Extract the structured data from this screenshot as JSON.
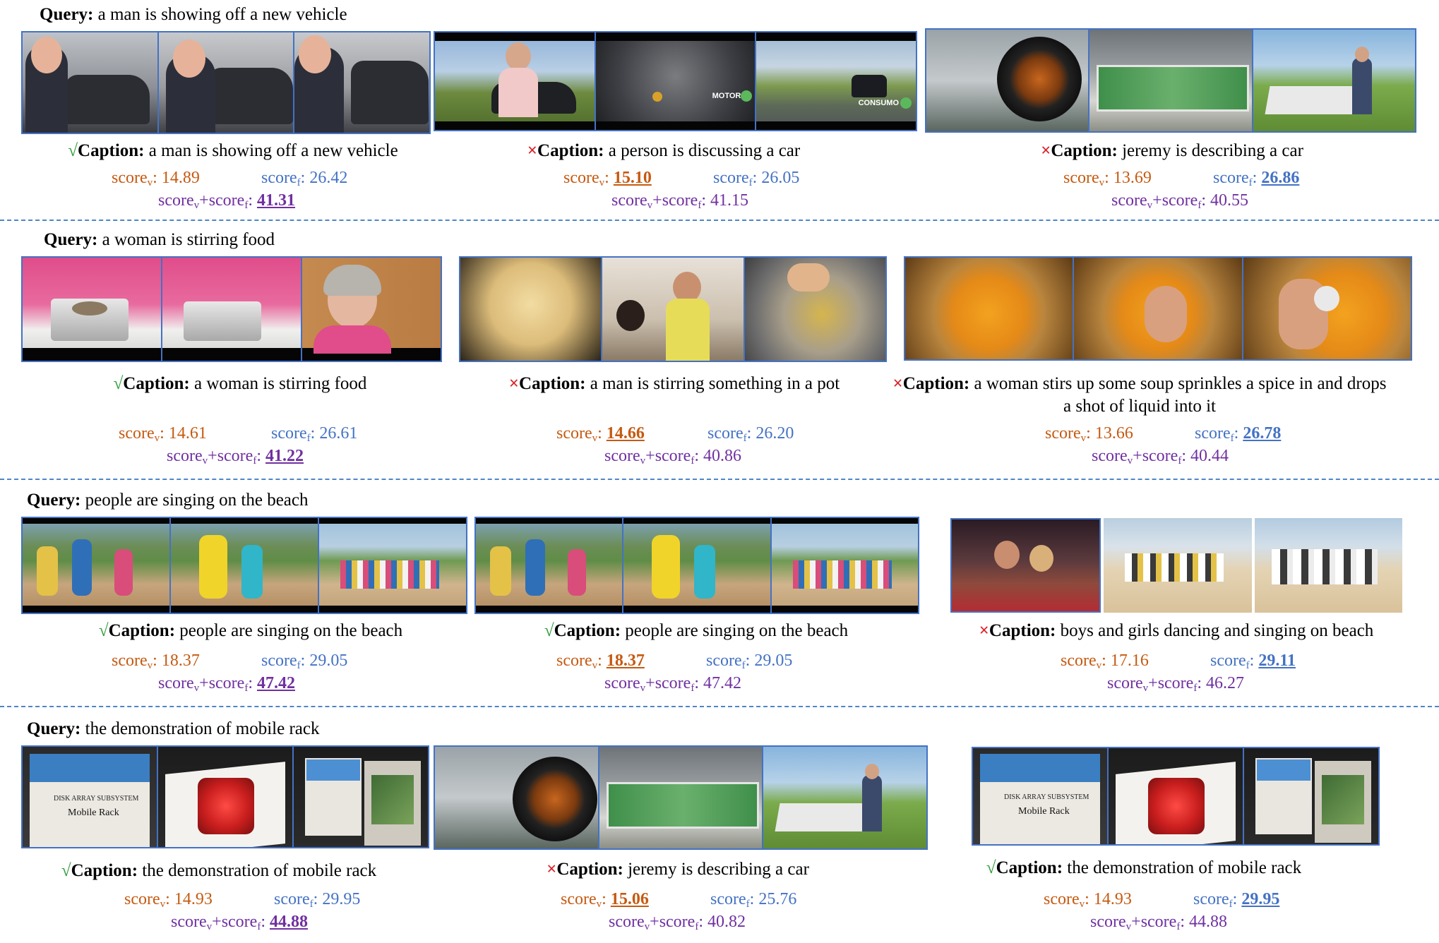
{
  "rows": [
    {
      "query_label": "Query:",
      "query_text": "a man is showing off a new vehicle",
      "results": [
        {
          "mark": "√",
          "correct": true,
          "caption_label": "Caption:",
          "caption_text": "a man is showing off a new vehicle",
          "score_v": "14.89",
          "score_f": "26.42",
          "score_sum": "41.31",
          "best": "sum",
          "frame_text": []
        },
        {
          "mark": "×",
          "correct": false,
          "caption_label": "Caption:",
          "caption_text": "a person is discussing a car",
          "score_v": "15.10",
          "score_f": "26.05",
          "score_sum": "41.15",
          "best": "v",
          "frame_text": [
            "MOTOR",
            "CONSUMO"
          ]
        },
        {
          "mark": "×",
          "correct": false,
          "caption_label": "Caption:",
          "caption_text": "jeremy is describing a car",
          "score_v": "13.69",
          "score_f": "26.86",
          "score_sum": "40.55",
          "best": "f",
          "frame_text": []
        }
      ]
    },
    {
      "query_label": "Query:",
      "query_text": "a woman is stirring food",
      "results": [
        {
          "mark": "√",
          "correct": true,
          "caption_label": "Caption:",
          "caption_text": "a woman is stirring food",
          "score_v": "14.61",
          "score_f": "26.61",
          "score_sum": "41.22",
          "best": "sum",
          "frame_text": []
        },
        {
          "mark": "×",
          "correct": false,
          "caption_label": "Caption:",
          "caption_text": "a man is stirring something in a pot",
          "score_v": "14.66",
          "score_f": "26.20",
          "score_sum": "40.86",
          "best": "v",
          "frame_text": []
        },
        {
          "mark": "×",
          "correct": false,
          "caption_label": "Caption:",
          "caption_text": "a woman stirs up some soup sprinkles a spice in and drops a shot of liquid into it",
          "score_v": "13.66",
          "score_f": "26.78",
          "score_sum": "40.44",
          "best": "f",
          "frame_text": []
        }
      ]
    },
    {
      "query_label": "Query:",
      "query_text": "people are singing on the beach",
      "results": [
        {
          "mark": "√",
          "correct": true,
          "caption_label": "Caption:",
          "caption_text": "people are singing on the beach",
          "score_v": "18.37",
          "score_f": "29.05",
          "score_sum": "47.42",
          "best": "sum",
          "frame_text": []
        },
        {
          "mark": "√",
          "correct": true,
          "caption_label": "Caption:",
          "caption_text": "people are singing on the beach",
          "score_v": "18.37",
          "score_f": "29.05",
          "score_sum": "47.42",
          "best": "v",
          "frame_text": []
        },
        {
          "mark": "×",
          "correct": false,
          "caption_label": "Caption:",
          "caption_text": "boys and girls dancing and singing on beach",
          "score_v": "17.16",
          "score_f": "29.11",
          "score_sum": "46.27",
          "best": "f",
          "frame_text": []
        }
      ]
    },
    {
      "query_label": "Query:",
      "query_text": "the demonstration of mobile rack",
      "results": [
        {
          "mark": "√",
          "correct": true,
          "caption_label": "Caption:",
          "caption_text": "the demonstration of mobile rack",
          "score_v": "14.93",
          "score_f": "29.95",
          "score_sum": "44.88",
          "best": "sum",
          "frame_text": [
            "DISK ARRAY SUBSYSTEM",
            "Mobile Rack"
          ]
        },
        {
          "mark": "×",
          "correct": false,
          "caption_label": "Caption:",
          "caption_text": "jeremy is describing a car",
          "score_v": "15.06",
          "score_f": "25.76",
          "score_sum": "40.82",
          "best": "v",
          "frame_text": []
        },
        {
          "mark": "√",
          "correct": true,
          "caption_label": "Caption:",
          "caption_text": "the demonstration of mobile rack",
          "score_v": "14.93",
          "score_f": "29.95",
          "score_sum": "44.88",
          "best": "f",
          "frame_text": [
            "DISK ARRAY SUBSYSTEM",
            "Mobile Rack"
          ]
        }
      ]
    }
  ],
  "score_labels": {
    "v_base": "score",
    "v_sub": "v",
    "f_base": "score",
    "f_sub": "f",
    "colon": ":",
    "plus": "+"
  },
  "colors": {
    "score_v": "#c55a11",
    "score_f": "#4472c4",
    "score_sum": "#7030a0",
    "correct": "#2e9e3a",
    "wrong": "#d9262c",
    "frame_border": "#4472c4"
  }
}
